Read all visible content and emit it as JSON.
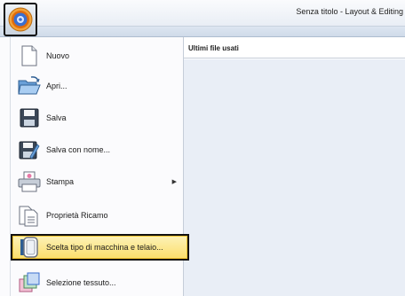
{
  "window": {
    "title": "Senza titolo - Layout & Editing"
  },
  "app_button": {
    "icon": "app-logo-icon"
  },
  "menu": {
    "items": [
      {
        "label": "Nuovo",
        "icon": "new-file-icon",
        "submenu": false
      },
      {
        "label": "Apri...",
        "icon": "open-folder-icon",
        "submenu": false
      },
      {
        "label": "Salva",
        "icon": "save-disk-icon",
        "submenu": false
      },
      {
        "label": "Salva con nome...",
        "icon": "save-as-icon",
        "submenu": false
      },
      {
        "label": "Stampa",
        "icon": "printer-icon",
        "submenu": true
      },
      {
        "label": "Proprietà Ricamo",
        "icon": "properties-document-icon",
        "submenu": false
      },
      {
        "label": "Scelta tipo di macchina e telaio...",
        "icon": "hoop-frame-icon",
        "submenu": false,
        "highlighted": true
      },
      {
        "label": "Selezione tessuto...",
        "icon": "fabric-select-icon",
        "submenu": false
      }
    ]
  },
  "recent": {
    "header": "Ultimi file usati",
    "files": []
  },
  "colors": {
    "highlight_top": "#fdf2b8",
    "highlight_bottom": "#fbde6a",
    "recent_background": "#e9eef6",
    "ribbon": "#cfdbe9"
  }
}
